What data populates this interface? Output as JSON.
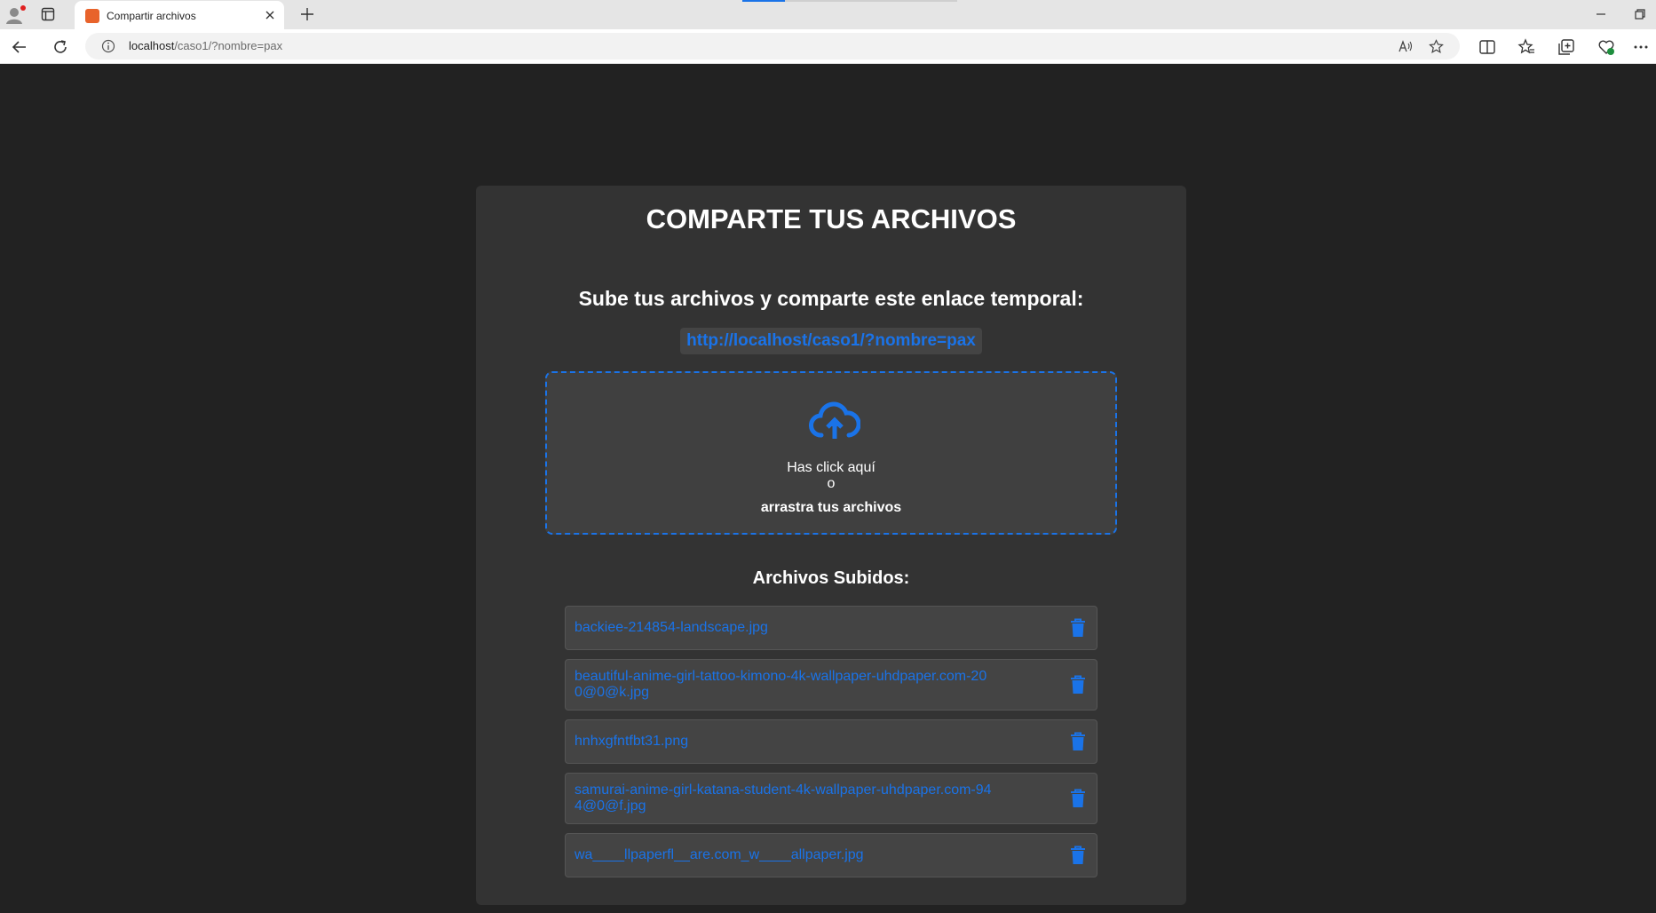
{
  "browser": {
    "tab_title": "Compartir archivos",
    "url_host": "localhost",
    "url_path": "/caso1/?nombre=pax"
  },
  "colors": {
    "accent": "#1a73e8",
    "page_bg": "#222222",
    "card_bg": "#333333",
    "item_bg": "#444444"
  },
  "main": {
    "title": "COMPARTE TUS ARCHIVOS",
    "subtitle": "Sube tus archivos y comparte este enlace temporal:",
    "share_link": "http://localhost/caso1/?nombre=pax",
    "dropzone": {
      "icon": "cloud-upload-icon",
      "line1": "Has click aquí",
      "line2": "o",
      "line3": "arrastra tus archivos"
    },
    "files_heading": "Archivos Subidos:",
    "files": [
      {
        "name": "backiee-214854-landscape.jpg"
      },
      {
        "name": "beautiful-anime-girl-tattoo-kimono-4k-wallpaper-uhdpaper.com-200@0@k.jpg"
      },
      {
        "name": "hnhxgfntfbt31.png"
      },
      {
        "name": "samurai-anime-girl-katana-student-4k-wallpaper-uhdpaper.com-944@0@f.jpg"
      },
      {
        "name": "wa____llpaperfl__are.com_w____allpaper.jpg"
      }
    ]
  }
}
